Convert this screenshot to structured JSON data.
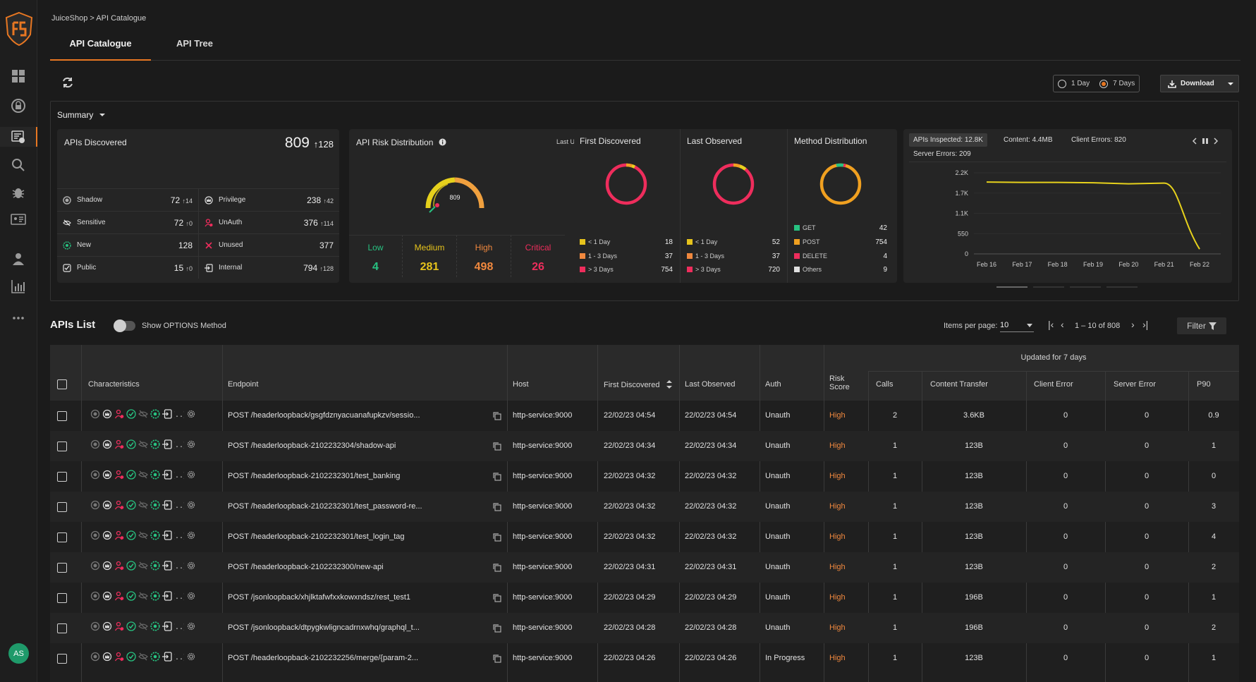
{
  "breadcrumb": "JuiceShop > API Catalogue",
  "tabs": [
    "API Catalogue",
    "API Tree"
  ],
  "user_initials": "AS",
  "range": {
    "opt1": "1 Day",
    "opt2": "7 Days",
    "selected": "7 Days"
  },
  "download_label": "Download",
  "summary_label": "Summary",
  "apis_discovered": {
    "title": "APIs Discovered",
    "total": "809",
    "total_delta": "128",
    "items": [
      {
        "label": "Shadow",
        "value": "72",
        "delta": "14"
      },
      {
        "label": "Privilege",
        "value": "238",
        "delta": "42"
      },
      {
        "label": "Sensitive",
        "value": "72",
        "delta": "0"
      },
      {
        "label": "UnAuth",
        "value": "376",
        "delta": "114"
      },
      {
        "label": "New",
        "value": "128",
        "delta": ""
      },
      {
        "label": "Unused",
        "value": "377",
        "delta": ""
      },
      {
        "label": "Public",
        "value": "15",
        "delta": "0"
      },
      {
        "label": "Internal",
        "value": "794",
        "delta": "128"
      }
    ]
  },
  "risk": {
    "title": "API Risk Distribution",
    "last_updated": "Last Updated:",
    "gauge_value": "809",
    "levels": [
      {
        "label": "Low",
        "value": "4",
        "color": "#27c281"
      },
      {
        "label": "Medium",
        "value": "281",
        "color": "#e6c31c"
      },
      {
        "label": "High",
        "value": "498",
        "color": "#f0883e"
      },
      {
        "label": "Critical",
        "value": "26",
        "color": "#ee2d5c"
      }
    ]
  },
  "first_discovered": {
    "title": "First Discovered",
    "legend": [
      {
        "label": "< 1 Day",
        "value": "18",
        "color": "#e6c31c"
      },
      {
        "label": "1 - 3 Days",
        "value": "37",
        "color": "#f0883e"
      },
      {
        "label": "> 3 Days",
        "value": "754",
        "color": "#ee2d5c"
      }
    ]
  },
  "last_observed": {
    "title": "Last Observed",
    "legend": [
      {
        "label": "< 1 Day",
        "value": "52",
        "color": "#e6c31c"
      },
      {
        "label": "1 - 3 Days",
        "value": "37",
        "color": "#f0883e"
      },
      {
        "label": "> 3 Days",
        "value": "720",
        "color": "#ee2d5c"
      }
    ]
  },
  "method_distribution": {
    "title": "Method Distribution",
    "legend": [
      {
        "label": "GET",
        "value": "42",
        "color": "#27c281"
      },
      {
        "label": "POST",
        "value": "754",
        "color": "#f0a020"
      },
      {
        "label": "DELETE",
        "value": "4",
        "color": "#ee2d5c"
      },
      {
        "label": "Others",
        "value": "9",
        "color": "#e0e0e0"
      }
    ]
  },
  "metrics": {
    "apis_inspected": "APIs Inspected: 12.8K",
    "content": "Content: 4.4MB",
    "client_errors": "Client Errors: 820",
    "server_errors": "Server Errors: 209"
  },
  "chart_data": {
    "type": "line",
    "x": [
      "Feb 16",
      "Feb 17",
      "Feb 18",
      "Feb 19",
      "Feb 20",
      "Feb 21",
      "Feb 22"
    ],
    "series": [
      {
        "values": [
          1950,
          1940,
          1940,
          1930,
          1900,
          1920,
          130
        ]
      }
    ],
    "ytick_labels": [
      "0",
      "550",
      "1.1K",
      "1.7K",
      "2.2K"
    ],
    "ylim": [
      0,
      2200
    ],
    "color": "#e6d11c"
  },
  "list": {
    "title": "APIs List",
    "toggle_label": "Show OPTIONS Method",
    "items_per_page_label": "Items per page:",
    "items_per_page": "10",
    "page_range": "1 – 10 of 808",
    "filter_label": "Filter"
  },
  "columns": {
    "characteristics": "Characteristics",
    "endpoint": "Endpoint",
    "host": "Host",
    "first_discovered": "First Discovered",
    "last_observed": "Last Observed",
    "auth": "Auth",
    "risk_score": "Risk Score",
    "updated": "Updated for 7 days",
    "calls": "Calls",
    "content_transfer": "Content Transfer",
    "client_error": "Client Error",
    "server_error": "Server Error",
    "p90": "P90"
  },
  "rows": [
    {
      "endpoint": "POST /headerloopback/gsgfdznyacuanafupkzv/sessio...",
      "host": "http-service:9000",
      "first": "22/02/23 04:54",
      "last": "22/02/23 04:54",
      "auth": "Unauth",
      "risk": "High",
      "calls": "2",
      "content": "3.6KB",
      "client": "0",
      "server": "0",
      "p90": "0.9"
    },
    {
      "endpoint": "POST /headerloopback-2102232304/shadow-api",
      "host": "http-service:9000",
      "first": "22/02/23 04:34",
      "last": "22/02/23 04:34",
      "auth": "Unauth",
      "risk": "High",
      "calls": "1",
      "content": "123B",
      "client": "0",
      "server": "0",
      "p90": "1"
    },
    {
      "endpoint": "POST /headerloopback-2102232301/test_banking",
      "host": "http-service:9000",
      "first": "22/02/23 04:32",
      "last": "22/02/23 04:32",
      "auth": "Unauth",
      "risk": "High",
      "calls": "1",
      "content": "123B",
      "client": "0",
      "server": "0",
      "p90": "0"
    },
    {
      "endpoint": "POST /headerloopback-2102232301/test_password-re...",
      "host": "http-service:9000",
      "first": "22/02/23 04:32",
      "last": "22/02/23 04:32",
      "auth": "Unauth",
      "risk": "High",
      "calls": "1",
      "content": "123B",
      "client": "0",
      "server": "0",
      "p90": "3"
    },
    {
      "endpoint": "POST /headerloopback-2102232301/test_login_tag",
      "host": "http-service:9000",
      "first": "22/02/23 04:32",
      "last": "22/02/23 04:32",
      "auth": "Unauth",
      "risk": "High",
      "calls": "1",
      "content": "123B",
      "client": "0",
      "server": "0",
      "p90": "4"
    },
    {
      "endpoint": "POST /headerloopback-2102232300/new-api",
      "host": "http-service:9000",
      "first": "22/02/23 04:31",
      "last": "22/02/23 04:31",
      "auth": "Unauth",
      "risk": "High",
      "calls": "1",
      "content": "123B",
      "client": "0",
      "server": "0",
      "p90": "2"
    },
    {
      "endpoint": "POST /jsonloopback/xhjlktafwfxxkowxndsz/rest_test1",
      "host": "http-service:9000",
      "first": "22/02/23 04:29",
      "last": "22/02/23 04:29",
      "auth": "Unauth",
      "risk": "High",
      "calls": "1",
      "content": "196B",
      "client": "0",
      "server": "0",
      "p90": "1"
    },
    {
      "endpoint": "POST /jsonloopback/dtpygkwligncadrnxwhq/graphql_t...",
      "host": "http-service:9000",
      "first": "22/02/23 04:28",
      "last": "22/02/23 04:28",
      "auth": "Unauth",
      "risk": "High",
      "calls": "1",
      "content": "196B",
      "client": "0",
      "server": "0",
      "p90": "2"
    },
    {
      "endpoint": "POST /headerloopback-2102232256/merge/{param-2...",
      "host": "http-service:9000",
      "first": "22/02/23 04:26",
      "last": "22/02/23 04:26",
      "auth": "In Progress",
      "risk": "High",
      "calls": "1",
      "content": "123B",
      "client": "0",
      "server": "0",
      "p90": "1"
    }
  ]
}
